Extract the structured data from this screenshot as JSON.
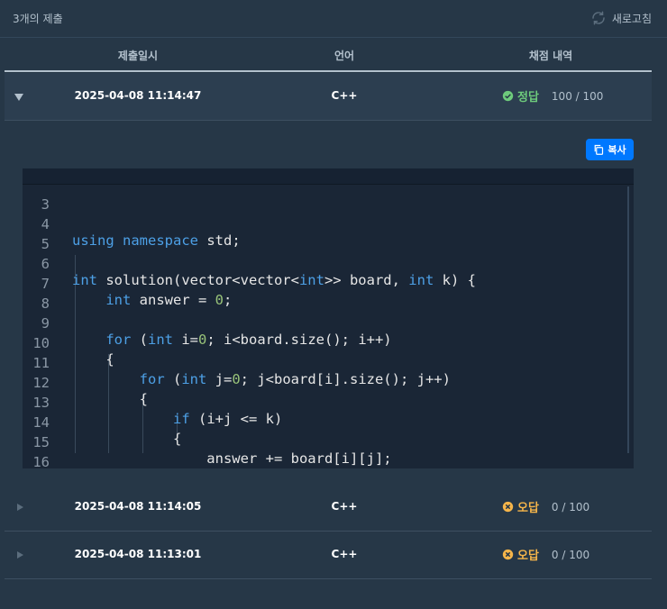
{
  "header": {
    "count_label": "3개의 제출",
    "refresh_label": "새로고침"
  },
  "table": {
    "columns": [
      "제출일시",
      "언어",
      "채점 내역"
    ]
  },
  "submissions": [
    {
      "date": "2025-04-08 11:14:47",
      "language": "C++",
      "status": "정답",
      "score": "100 / 100",
      "expanded": true
    },
    {
      "date": "2025-04-08 11:14:05",
      "language": "C++",
      "status": "오답",
      "score": "0 / 100",
      "expanded": false
    },
    {
      "date": "2025-04-08 11:13:01",
      "language": "C++",
      "status": "오답",
      "score": "0 / 100",
      "expanded": false
    }
  ],
  "copy_button": {
    "label": "복사"
  },
  "code": {
    "line_numbers": [
      "3",
      "4",
      "5",
      "6",
      "7",
      "8",
      "9",
      "10",
      "11",
      "12",
      "13",
      "14",
      "15",
      "16"
    ],
    "lines": [
      "",
      "using namespace std;",
      "",
      "int solution(vector<vector<int>> board, int k) {",
      "    int answer = 0;",
      "",
      "    for (int i=0; i<board.size(); i++)",
      "    {",
      "        for (int j=0; j<board[i].size(); j++)",
      "        {",
      "            if (i+j <= k)",
      "            {",
      "                answer += board[i][j];",
      "            }"
    ]
  },
  "colors": {
    "background": "#263747",
    "accent": "#0078ff",
    "correct": "#6ecb7c",
    "wrong": "#f5b54a"
  },
  "icons": {
    "refresh": "refresh-icon",
    "expand_open": "triangle-down-icon",
    "expand_closed": "triangle-right-icon",
    "correct": "check-circle-icon",
    "wrong": "x-circle-icon",
    "copy": "copy-icon"
  }
}
